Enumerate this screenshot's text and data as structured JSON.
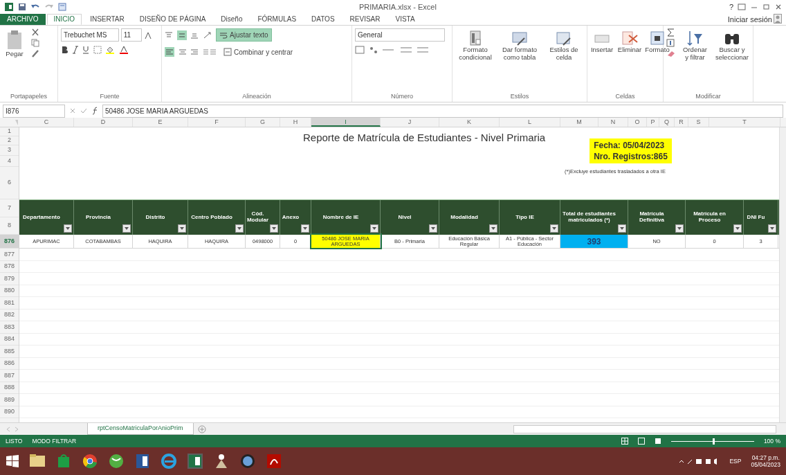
{
  "window": {
    "title": "PRIMARIA.xlsx - Excel",
    "help": "?",
    "sign_in": "Iniciar sesión"
  },
  "ribbon_tabs": [
    {
      "label": "ARCHIVO",
      "kind": "file",
      "selected": false
    },
    {
      "label": "INICIO",
      "kind": "tab",
      "selected": true
    },
    {
      "label": "INSERTAR",
      "kind": "tab",
      "selected": false
    },
    {
      "label": "DISEÑO DE PÁGINA",
      "kind": "tab",
      "selected": false
    },
    {
      "label": "Diseño",
      "kind": "tab",
      "selected": false
    },
    {
      "label": "FÓRMULAS",
      "kind": "tab",
      "selected": false
    },
    {
      "label": "DATOS",
      "kind": "tab",
      "selected": false
    },
    {
      "label": "REVISAR",
      "kind": "tab",
      "selected": false
    },
    {
      "label": "VISTA",
      "kind": "tab",
      "selected": false
    }
  ],
  "ribbon": {
    "paste": "Pegar",
    "font_name": "Trebuchet MS",
    "font_size": "11",
    "wrap_text": {
      "label": "Ajustar texto",
      "on": true
    },
    "merge": "Combinar y centrar",
    "number_format": "General",
    "styles_buttons": [
      "Formato condicional",
      "Dar formato como tabla",
      "Estilos de celda"
    ],
    "cells_buttons": [
      "Insertar",
      "Eliminar",
      "Formato"
    ],
    "edit_buttons": [
      "Ordenar y filtrar",
      "Buscar y seleccionar"
    ],
    "groups": [
      "Portapapeles",
      "Fuente",
      "Alineación",
      "Número",
      "Estilos",
      "Celdas",
      "Modificar"
    ]
  },
  "formula_bar": {
    "name_box": "I876",
    "formula": "50486 JOSE MARIA ARGUEDAS"
  },
  "column_letters": [
    {
      "label": "C",
      "selected": false
    },
    {
      "label": "D",
      "selected": false
    },
    {
      "label": "E",
      "selected": false
    },
    {
      "label": "F",
      "selected": false
    },
    {
      "label": "G",
      "selected": false
    },
    {
      "label": "H",
      "selected": false
    },
    {
      "label": "I",
      "selected": true
    },
    {
      "label": "J",
      "selected": false
    },
    {
      "label": "K",
      "selected": false
    },
    {
      "label": "L",
      "selected": false
    },
    {
      "label": "M",
      "selected": false
    },
    {
      "label": "N",
      "selected": false
    },
    {
      "label": "O",
      "selected": false
    },
    {
      "label": "P",
      "selected": false
    },
    {
      "label": "Q",
      "selected": false
    },
    {
      "label": "R",
      "selected": false
    },
    {
      "label": "S",
      "selected": false
    },
    {
      "label": "T",
      "selected": false
    }
  ],
  "sheet": {
    "top_row_numbers": [
      "1",
      "2",
      "3",
      "4",
      "6"
    ],
    "title": "Reporte de Matrícula de Estudiantes - Nivel Primaria",
    "info_box": [
      "Fecha: 05/04/2023",
      "Nro. Registros:865"
    ],
    "note": "(*)Excluye estudiantes trasladados a otra IE",
    "header_row_numbers": [
      "7",
      "8"
    ],
    "columns": [
      "Departamento",
      "Provincia",
      "Distrito",
      "Centro Poblado",
      "Cód. Modular",
      "Anexo",
      "Nombre de IE",
      "Nivel",
      "Modalidad",
      "Tipo IE",
      "Total de estudiantes matriculados (*)",
      "Matrícula Definitiva",
      "Matrícula en Proceso",
      "DNI Fu"
    ],
    "data_row": {
      "number": "876",
      "selected": true,
      "cells": [
        {
          "text": "APURIMAC"
        },
        {
          "text": "COTABAMBAS"
        },
        {
          "text": "HAQUIRA"
        },
        {
          "text": "HAQUIRA"
        },
        {
          "text": "0498000"
        },
        {
          "text": "0"
        },
        {
          "text": "50486 JOSE MARIA ARGUEDAS",
          "color": "#ffff00"
        },
        {
          "text": "B0 - Primaria"
        },
        {
          "text": "Educación Básica Regular"
        },
        {
          "text": "A1 - Pública - Sector Educación"
        },
        {
          "text": "393",
          "color": "#00b0f0",
          "bold": true
        },
        {
          "text": "NO"
        },
        {
          "text": "0"
        },
        {
          "text": "3"
        }
      ]
    },
    "empty_row_numbers": [
      "877",
      "878",
      "879",
      "880",
      "881",
      "882",
      "883",
      "884",
      "885",
      "886",
      "887",
      "888",
      "889",
      "890"
    ]
  },
  "sheet_tabs": [
    {
      "label": "rptCensoMatriculaPorAnioPrim",
      "selected": true
    }
  ],
  "status_bar": {
    "ready": "LISTO",
    "mode": "MODO FILTRAR",
    "zoom": "100 %",
    "zoom_level": {
      "level": 0.5
    }
  },
  "taskbar": {
    "language": "ESP",
    "time": "04:27 p.m.",
    "date": "05/04/2023"
  }
}
